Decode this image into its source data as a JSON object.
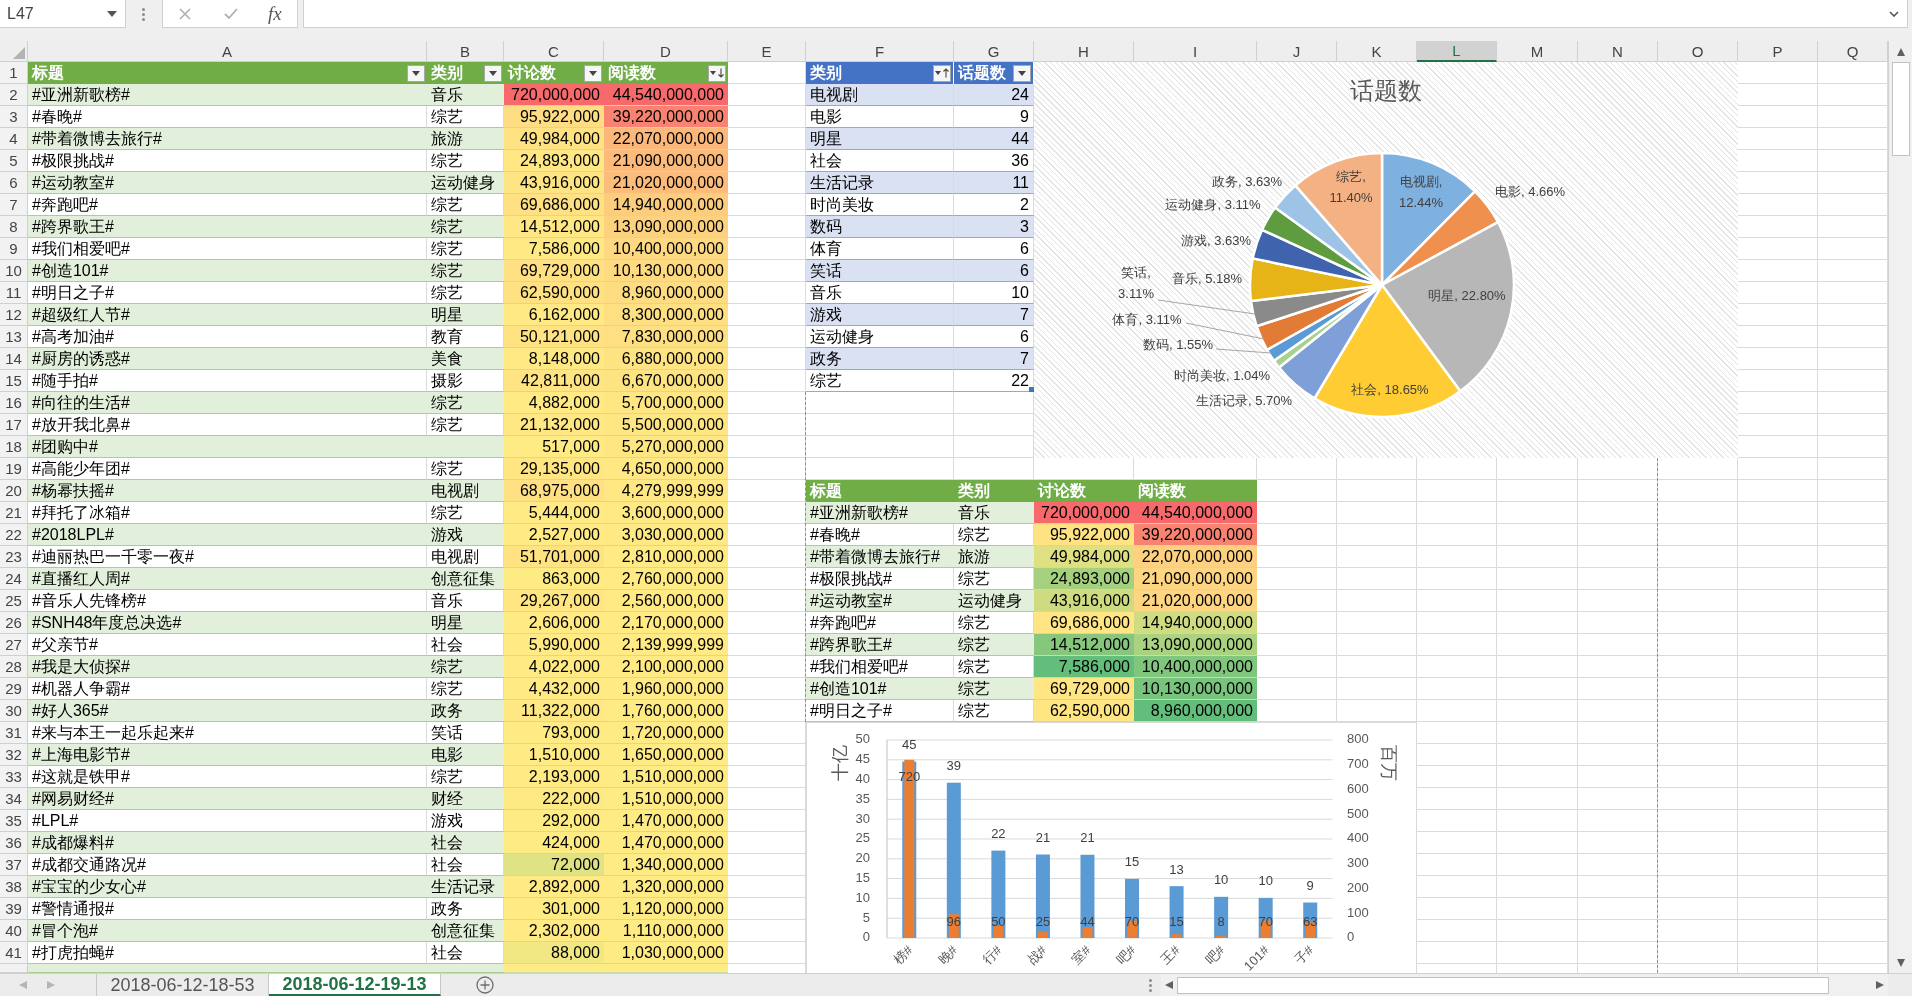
{
  "formula_bar": {
    "name_box": "L47",
    "function_button": "fx"
  },
  "column_headers": [
    {
      "label": "A",
      "selected": false
    },
    {
      "label": "B",
      "selected": false
    },
    {
      "label": "C",
      "selected": false
    },
    {
      "label": "D",
      "selected": false
    },
    {
      "label": "E",
      "selected": false
    },
    {
      "label": "F",
      "selected": false
    },
    {
      "label": "G",
      "selected": false
    },
    {
      "label": "H",
      "selected": false
    },
    {
      "label": "I",
      "selected": false
    },
    {
      "label": "J",
      "selected": false
    },
    {
      "label": "K",
      "selected": false
    },
    {
      "label": "L",
      "selected": true
    },
    {
      "label": "M",
      "selected": false
    },
    {
      "label": "N",
      "selected": false
    },
    {
      "label": "O",
      "selected": false
    },
    {
      "label": "P",
      "selected": false
    },
    {
      "label": "Q",
      "selected": false
    }
  ],
  "row_headers": [
    "1",
    "2",
    "3",
    "4",
    "5",
    "6",
    "7",
    "8",
    "9",
    "10",
    "11",
    "12",
    "13",
    "14",
    "15",
    "16",
    "17",
    "18",
    "19",
    "20",
    "21",
    "22",
    "23",
    "24",
    "25",
    "26",
    "27",
    "28",
    "29",
    "30",
    "31",
    "32",
    "33",
    "34",
    "35",
    "36",
    "37",
    "38",
    "39",
    "40",
    "41"
  ],
  "topics_table": {
    "columns": [
      {
        "label": "标题",
        "sort_descending": false
      },
      {
        "label": "类别",
        "sort_descending": false
      },
      {
        "label": "讨论数",
        "sort_descending": false
      },
      {
        "label": "阅读数",
        "sort_descending": true
      }
    ],
    "rows": [
      {
        "title": "#亚洲新歌榜#",
        "category": "音乐",
        "discussions": {
          "text": "720,000,000",
          "color": "#f8696b"
        },
        "reads": {
          "text": "44,540,000,000",
          "color": "#f8696b"
        }
      },
      {
        "title": "#春晚#",
        "category": "综艺",
        "discussions": {
          "text": "95,922,000",
          "color": "#ffdd82"
        },
        "reads": {
          "text": "39,220,000,000",
          "color": "#f98370"
        }
      },
      {
        "title": "#带着微博去旅行#",
        "category": "旅游",
        "discussions": {
          "text": "49,984,000",
          "color": "#ffe383"
        },
        "reads": {
          "text": "22,070,000,000",
          "color": "#fcb77a"
        }
      },
      {
        "title": "#极限挑战#",
        "category": "综艺",
        "discussions": {
          "text": "24,893,000",
          "color": "#ffe784"
        },
        "reads": {
          "text": "21,090,000,000",
          "color": "#fcbb7b"
        }
      },
      {
        "title": "#运动教室#",
        "category": "运动健身",
        "discussions": {
          "text": "43,916,000",
          "color": "#ffe483"
        },
        "reads": {
          "text": "21,020,000,000",
          "color": "#fcbc7b"
        }
      },
      {
        "title": "#奔跑吧#",
        "category": "综艺",
        "discussions": {
          "text": "69,686,000",
          "color": "#ffe082"
        },
        "reads": {
          "text": "14,940,000,000",
          "color": "#fdcd7e"
        }
      },
      {
        "title": "#跨界歌王#",
        "category": "综艺",
        "discussions": {
          "text": "14,512,000",
          "color": "#ffe884"
        },
        "reads": {
          "text": "13,090,000,000",
          "color": "#fdd27f"
        }
      },
      {
        "title": "#我们相爱吧#",
        "category": "综艺",
        "discussions": {
          "text": "7,586,000",
          "color": "#ffe984"
        },
        "reads": {
          "text": "10,400,000,000",
          "color": "#fed981"
        }
      },
      {
        "title": "#创造101#",
        "category": "综艺",
        "discussions": {
          "text": "69,729,000",
          "color": "#ffe082"
        },
        "reads": {
          "text": "10,130,000,000",
          "color": "#feda81"
        }
      },
      {
        "title": "#明日之子#",
        "category": "综艺",
        "discussions": {
          "text": "62,590,000",
          "color": "#ffe182"
        },
        "reads": {
          "text": "8,960,000,000",
          "color": "#fedd82"
        }
      },
      {
        "title": "#超级红人节#",
        "category": "明星",
        "discussions": {
          "text": "6,162,000",
          "color": "#ffe984"
        },
        "reads": {
          "text": "8,300,000,000",
          "color": "#fedf82"
        }
      },
      {
        "title": "#高考加油#",
        "category": "教育",
        "discussions": {
          "text": "50,121,000",
          "color": "#ffe383"
        },
        "reads": {
          "text": "7,830,000,000",
          "color": "#fee082"
        }
      },
      {
        "title": "#厨房的诱惑#",
        "category": "美食",
        "discussions": {
          "text": "8,148,000",
          "color": "#ffe984"
        },
        "reads": {
          "text": "6,880,000,000",
          "color": "#fee382"
        }
      },
      {
        "title": "#随手拍#",
        "category": "摄影",
        "discussions": {
          "text": "42,811,000",
          "color": "#ffe483"
        },
        "reads": {
          "text": "6,670,000,000",
          "color": "#fee383"
        }
      },
      {
        "title": "#向往的生活#",
        "category": "综艺",
        "discussions": {
          "text": "4,882,000",
          "color": "#ffea84"
        },
        "reads": {
          "text": "5,700,000,000",
          "color": "#fee683"
        }
      },
      {
        "title": "#放开我北鼻#",
        "category": "综艺",
        "discussions": {
          "text": "21,132,000",
          "color": "#ffe784"
        },
        "reads": {
          "text": "5,500,000,000",
          "color": "#fee683"
        }
      },
      {
        "title": "#团购中#",
        "discussions": {
          "text": "517,000",
          "color": "#ffeb84"
        },
        "reads": {
          "text": "5,270,000,000",
          "color": "#fee783"
        }
      },
      {
        "title": "#高能少年团#",
        "category": "综艺",
        "discussions": {
          "text": "29,135,000",
          "color": "#ffe683"
        },
        "reads": {
          "text": "4,650,000,000",
          "color": "#ffe883"
        }
      },
      {
        "title": "#杨幂扶摇#",
        "category": "电视剧",
        "discussions": {
          "text": "68,975,000",
          "color": "#ffe082"
        },
        "reads": {
          "text": "4,279,999,999",
          "color": "#ffe883"
        }
      },
      {
        "title": "#拜托了冰箱#",
        "category": "综艺",
        "discussions": {
          "text": "5,444,000",
          "color": "#ffea84"
        },
        "reads": {
          "text": "3,600,000,000",
          "color": "#ffe984"
        }
      },
      {
        "title": "#2018LPL#",
        "category": "游戏",
        "discussions": {
          "text": "2,527,000",
          "color": "#ffea84"
        },
        "reads": {
          "text": "3,030,000,000",
          "color": "#ffe984"
        }
      },
      {
        "title": "#迪丽热巴一千零一夜#",
        "category": "电视剧",
        "discussions": {
          "text": "51,701,000",
          "color": "#ffe383"
        },
        "reads": {
          "text": "2,810,000,000",
          "color": "#ffea84"
        }
      },
      {
        "title": "#直播红人周#",
        "category": "创意征集",
        "discussions": {
          "text": "863,000",
          "color": "#ffeb84"
        },
        "reads": {
          "text": "2,760,000,000",
          "color": "#ffea84"
        }
      },
      {
        "title": "#音乐人先锋榜#",
        "category": "音乐",
        "discussions": {
          "text": "29,267,000",
          "color": "#ffe683"
        },
        "reads": {
          "text": "2,560,000,000",
          "color": "#ffea84"
        }
      },
      {
        "title": "#SNH48年度总决选#",
        "category": "明星",
        "discussions": {
          "text": "2,606,000",
          "color": "#ffea84"
        },
        "reads": {
          "text": "2,170,000,000",
          "color": "#ffea84"
        }
      },
      {
        "title": "#父亲节#",
        "category": "社会",
        "discussions": {
          "text": "5,990,000",
          "color": "#ffea84"
        },
        "reads": {
          "text": "2,139,999,999",
          "color": "#ffea84"
        }
      },
      {
        "title": "#我是大侦探#",
        "category": "综艺",
        "discussions": {
          "text": "4,022,000",
          "color": "#ffea84"
        },
        "reads": {
          "text": "2,100,000,000",
          "color": "#ffea84"
        }
      },
      {
        "title": "#机器人争霸#",
        "category": "综艺",
        "discussions": {
          "text": "4,432,000",
          "color": "#ffea84"
        },
        "reads": {
          "text": "1,960,000,000",
          "color": "#ffea84"
        }
      },
      {
        "title": "#好人365#",
        "category": "政务",
        "discussions": {
          "text": "11,322,000",
          "color": "#ffe884"
        },
        "reads": {
          "text": "1,760,000,000",
          "color": "#ffeb84"
        }
      },
      {
        "title": "#来与本王一起乐起来#",
        "category": "笑话",
        "discussions": {
          "text": "793,000",
          "color": "#ffeb84"
        },
        "reads": {
          "text": "1,720,000,000",
          "color": "#ffeb84"
        }
      },
      {
        "title": "#上海电影节#",
        "category": "电影",
        "discussions": {
          "text": "1,510,000",
          "color": "#ffeb84"
        },
        "reads": {
          "text": "1,650,000,000",
          "color": "#ffeb84"
        }
      },
      {
        "title": "#这就是铁甲#",
        "category": "综艺",
        "discussions": {
          "text": "2,193,000",
          "color": "#ffea84"
        },
        "reads": {
          "text": "1,510,000,000",
          "color": "#ffeb84"
        }
      },
      {
        "title": "#网易财经#",
        "category": "财经",
        "discussions": {
          "text": "222,000",
          "color": "#fdea84"
        },
        "reads": {
          "text": "1,510,000,000",
          "color": "#ffeb84"
        }
      },
      {
        "title": "#LPL#",
        "category": "游戏",
        "discussions": {
          "text": "292,000",
          "color": "#feeb84"
        },
        "reads": {
          "text": "1,470,000,000",
          "color": "#ffeb84"
        }
      },
      {
        "title": "#成都爆料#",
        "category": "社会",
        "discussions": {
          "text": "424,000",
          "color": "#ffeb84"
        },
        "reads": {
          "text": "1,470,000,000",
          "color": "#ffeb84"
        }
      },
      {
        "title": "#成都交通路况#",
        "category": "社会",
        "discussions": {
          "text": "72,000",
          "color": "#dfe383"
        },
        "reads": {
          "text": "1,340,000,000",
          "color": "#ffeb84"
        }
      },
      {
        "title": "#宝宝的少女心#",
        "category": "生活记录",
        "discussions": {
          "text": "2,892,000",
          "color": "#ffea84"
        },
        "reads": {
          "text": "1,320,000,000",
          "color": "#ffeb84"
        }
      },
      {
        "title": "#警情通报#",
        "category": "政务",
        "discussions": {
          "text": "301,000",
          "color": "#ffeb84"
        },
        "reads": {
          "text": "1,120,000,000",
          "color": "#ffeb84"
        }
      },
      {
        "title": "#冒个泡#",
        "category": "创意征集",
        "discussions": {
          "text": "2,302,000",
          "color": "#ffea84"
        },
        "reads": {
          "text": "1,110,000,000",
          "color": "#ffeb84"
        }
      },
      {
        "title": "#打虎拍蝇#",
        "category": "社会",
        "discussions": {
          "text": "88,000",
          "color": "#f1e884"
        },
        "reads": {
          "text": "1,030,000,000",
          "color": "#ffeb84"
        }
      },
      {
        "discussions": {
          "color": "#ffeb84"
        },
        "reads": {
          "color": "#ffeb84"
        }
      }
    ]
  },
  "category_table": {
    "columns": [
      {
        "label": "类别",
        "sort_ascending": true
      },
      {
        "label": "话题数",
        "sort_ascending": false
      }
    ],
    "rows": [
      {
        "category": "电视剧",
        "count": "24"
      },
      {
        "category": "电影",
        "count": "9"
      },
      {
        "category": "明星",
        "count": "44"
      },
      {
        "category": "社会",
        "count": "36"
      },
      {
        "category": "生活记录",
        "count": "11"
      },
      {
        "category": "时尚美妆",
        "count": "2"
      },
      {
        "category": "数码",
        "count": "3"
      },
      {
        "category": "体育",
        "count": "6"
      },
      {
        "category": "笑话",
        "count": "6"
      },
      {
        "category": "音乐",
        "count": "10"
      },
      {
        "category": "游戏",
        "count": "7"
      },
      {
        "category": "运动健身",
        "count": "6"
      },
      {
        "category": "政务",
        "count": "7"
      },
      {
        "category": "综艺",
        "count": "22"
      }
    ]
  },
  "pie_chart": {
    "chart_data": {
      "type": "pie",
      "title": "话题数",
      "values": [
        12.44,
        4.66,
        22.8,
        18.65,
        5.7,
        1.04,
        1.55,
        3.11,
        3.11,
        5.18,
        3.63,
        3.11,
        3.63,
        11.4
      ],
      "colors": [
        "#7fb1e0",
        "#f0904f",
        "#b7b7b7",
        "#ffcc33",
        "#7f9fd9",
        "#a9d18e",
        "#5b9bd5",
        "#e27b36",
        "#8a8a8a",
        "#e6b416",
        "#3f64ad",
        "#5e9c3f",
        "#9dc3e6",
        "#f4b183"
      ],
      "value_labels": [
        "电视剧, 12.44%",
        "电影, 4.66%",
        "明星, 22.80%",
        "社会, 18.65%",
        "生活记录, 5.70%",
        "时尚美妆, 1.04%",
        "数码, 1.55%",
        "体育, 3.11%",
        "笑话, 3.11%",
        "音乐, 5.18%",
        "游戏, 3.63%",
        "运动健身, 3.11%",
        "政务, 3.63%",
        "综艺, 11.40%"
      ]
    }
  },
  "top10_table": {
    "columns": [
      "标题",
      "类别",
      "讨论数",
      "阅读数"
    ],
    "rows": [
      {
        "title": "#亚洲新歌榜#",
        "category": "音乐",
        "discussions": {
          "text": "720,000,000",
          "color": "#f8696b"
        },
        "reads": {
          "text": "44,540,000,000",
          "color": "#f8696b"
        }
      },
      {
        "title": "#春晚#",
        "category": "综艺",
        "discussions": {
          "text": "95,922,000",
          "color": "#ffe383"
        },
        "reads": {
          "text": "39,220,000,000",
          "color": "#f98370"
        }
      },
      {
        "title": "#带着微博去旅行#",
        "category": "旅游",
        "discussions": {
          "text": "49,984,000",
          "color": "#dfe082"
        },
        "reads": {
          "text": "22,070,000,000",
          "color": "#fdd17f"
        }
      },
      {
        "title": "#极限挑战#",
        "category": "综艺",
        "discussions": {
          "text": "24,893,000",
          "color": "#a5d07e"
        },
        "reads": {
          "text": "21,090,000,000",
          "color": "#fed580"
        }
      },
      {
        "title": "#运动教室#",
        "category": "运动健身",
        "discussions": {
          "text": "43,916,000",
          "color": "#cfdb80"
        },
        "reads": {
          "text": "21,020,000,000",
          "color": "#fed580"
        }
      },
      {
        "title": "#奔跑吧#",
        "category": "综艺",
        "discussions": {
          "text": "69,686,000",
          "color": "#ffe583"
        },
        "reads": {
          "text": "14,940,000,000",
          "color": "#cfdc81"
        }
      },
      {
        "title": "#跨界歌王#",
        "category": "综艺",
        "discussions": {
          "text": "14,512,000",
          "color": "#86c77d"
        },
        "reads": {
          "text": "13,090,000,000",
          "color": "#aad380"
        }
      },
      {
        "title": "#我们相爱吧#",
        "category": "综艺",
        "discussions": {
          "text": "7,586,000",
          "color": "#63be7b"
        },
        "reads": {
          "text": "10,400,000,000",
          "color": "#80c77d"
        }
      },
      {
        "title": "#创造101#",
        "category": "综艺",
        "discussions": {
          "text": "69,729,000",
          "color": "#ffe583"
        },
        "reads": {
          "text": "10,130,000,000",
          "color": "#79c47c"
        }
      },
      {
        "title": "#明日之子#",
        "category": "综艺",
        "discussions": {
          "text": "62,590,000",
          "color": "#ffe683"
        },
        "reads": {
          "text": "8,960,000,000",
          "color": "#63be7b"
        }
      }
    ]
  },
  "bar_chart": {
    "chart_data": {
      "type": "bar",
      "grid": true,
      "stacked": false,
      "ylabel": "十亿",
      "ylim": [
        0,
        50
      ],
      "yticks": [
        0,
        5,
        10,
        15,
        20,
        25,
        30,
        35,
        40,
        45,
        50
      ],
      "y2label": "百万",
      "y2lim": [
        0,
        800
      ],
      "y2ticks": [
        0,
        100,
        200,
        300,
        400,
        500,
        600,
        700,
        800
      ],
      "categories": [
        "榜#",
        "晚#",
        "行#",
        "战#",
        "室#",
        "吧#",
        "王#",
        "吧#",
        "101#",
        "子#"
      ],
      "series": [
        {
          "color": "#5b9bd5",
          "values": [
            44.54,
            39.22,
            22.07,
            21.09,
            21.02,
            14.94,
            13.09,
            10.4,
            10.13,
            8.96
          ],
          "value_labels": [
            "45",
            "39",
            "22",
            "21",
            "21",
            "15",
            "13",
            "10",
            "10",
            "9"
          ]
        },
        {
          "color": "#ed7d31",
          "axis": "y2",
          "values": [
            720,
            96,
            50,
            25,
            44,
            70,
            15,
            8,
            70,
            63
          ],
          "value_labels": [
            "720",
            "96",
            "50",
            "25",
            "44",
            "70",
            "15",
            "8",
            "70",
            "63"
          ]
        }
      ]
    }
  },
  "sheet_tabs": [
    {
      "label": "2018-06-12-18-53",
      "selected": false
    },
    {
      "label": "2018-06-12-19-13",
      "selected": true
    }
  ]
}
